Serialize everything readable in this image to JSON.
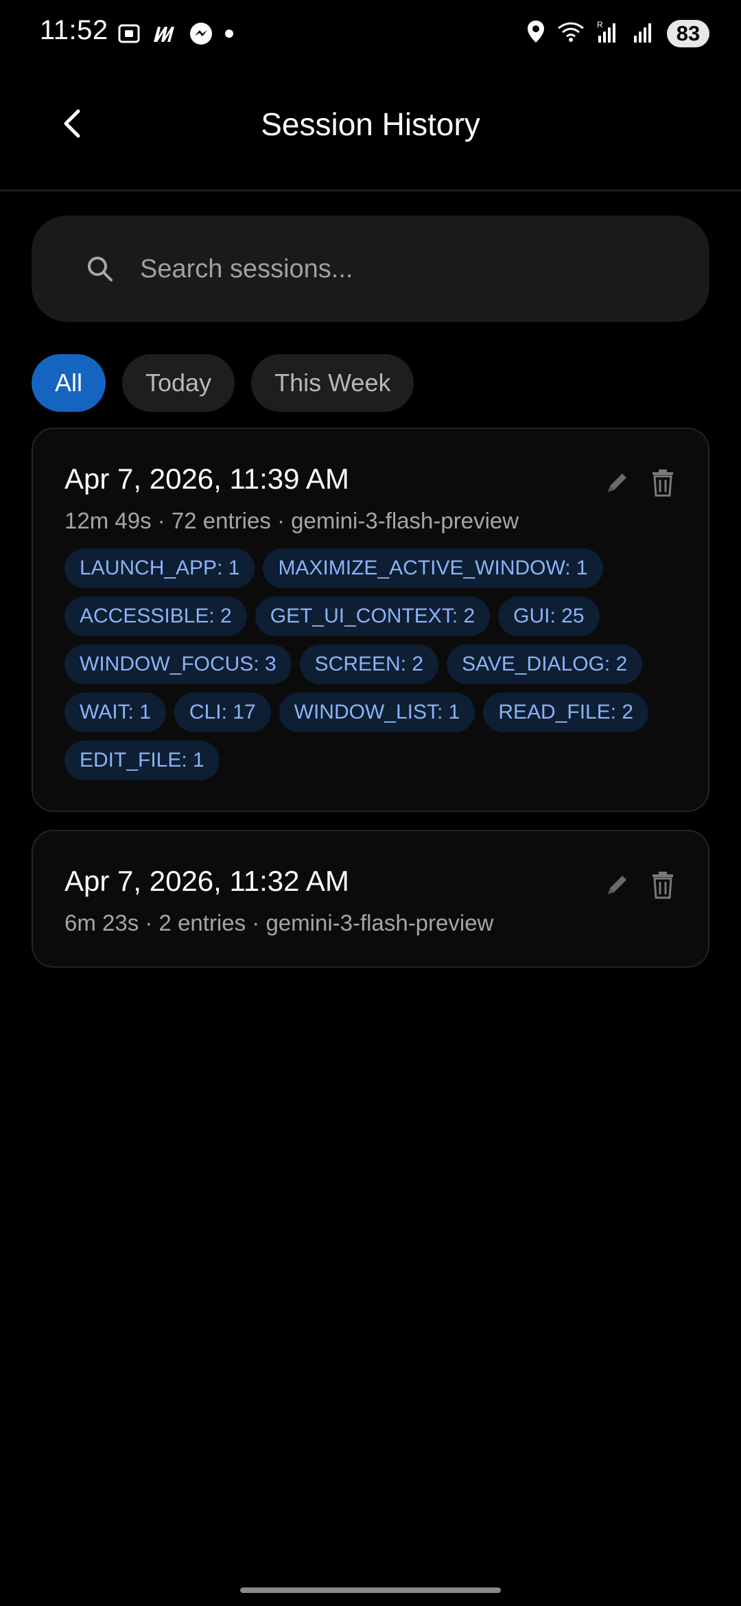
{
  "status_bar": {
    "time": "11:52",
    "battery": "83",
    "left_icons": [
      "screenshot-icon",
      "m-app-icon",
      "messenger-icon",
      "dot-icon"
    ],
    "right_icons": [
      "location-icon",
      "wifi-icon",
      "signal-r-icon",
      "signal-icon"
    ]
  },
  "header": {
    "title": "Session History"
  },
  "search": {
    "placeholder": "Search sessions..."
  },
  "filters": [
    {
      "label": "All",
      "active": true
    },
    {
      "label": "Today",
      "active": false
    },
    {
      "label": "This Week",
      "active": false
    }
  ],
  "sessions": [
    {
      "date": "Apr 7, 2026, 11:39 AM",
      "meta": "12m 49s  ·  72 entries  ·  gemini-3-flash-preview",
      "tags": [
        "LAUNCH_APP: 1",
        "MAXIMIZE_ACTIVE_WINDOW: 1",
        "ACCESSIBLE: 2",
        "GET_UI_CONTEXT: 2",
        "GUI: 25",
        "WINDOW_FOCUS: 3",
        "SCREEN: 2",
        "SAVE_DIALOG: 2",
        "WAIT: 1",
        "CLI: 17",
        "WINDOW_LIST: 1",
        "READ_FILE: 2",
        "EDIT_FILE: 1"
      ]
    },
    {
      "date": "Apr 7, 2026, 11:32 AM",
      "meta": "6m 23s  ·  2 entries  ·  gemini-3-flash-preview",
      "tags": []
    }
  ],
  "colors": {
    "accent": "#1565c0",
    "tag_text": "#8ab4f8",
    "tag_bg": "#0e1e33",
    "background": "#000000"
  }
}
